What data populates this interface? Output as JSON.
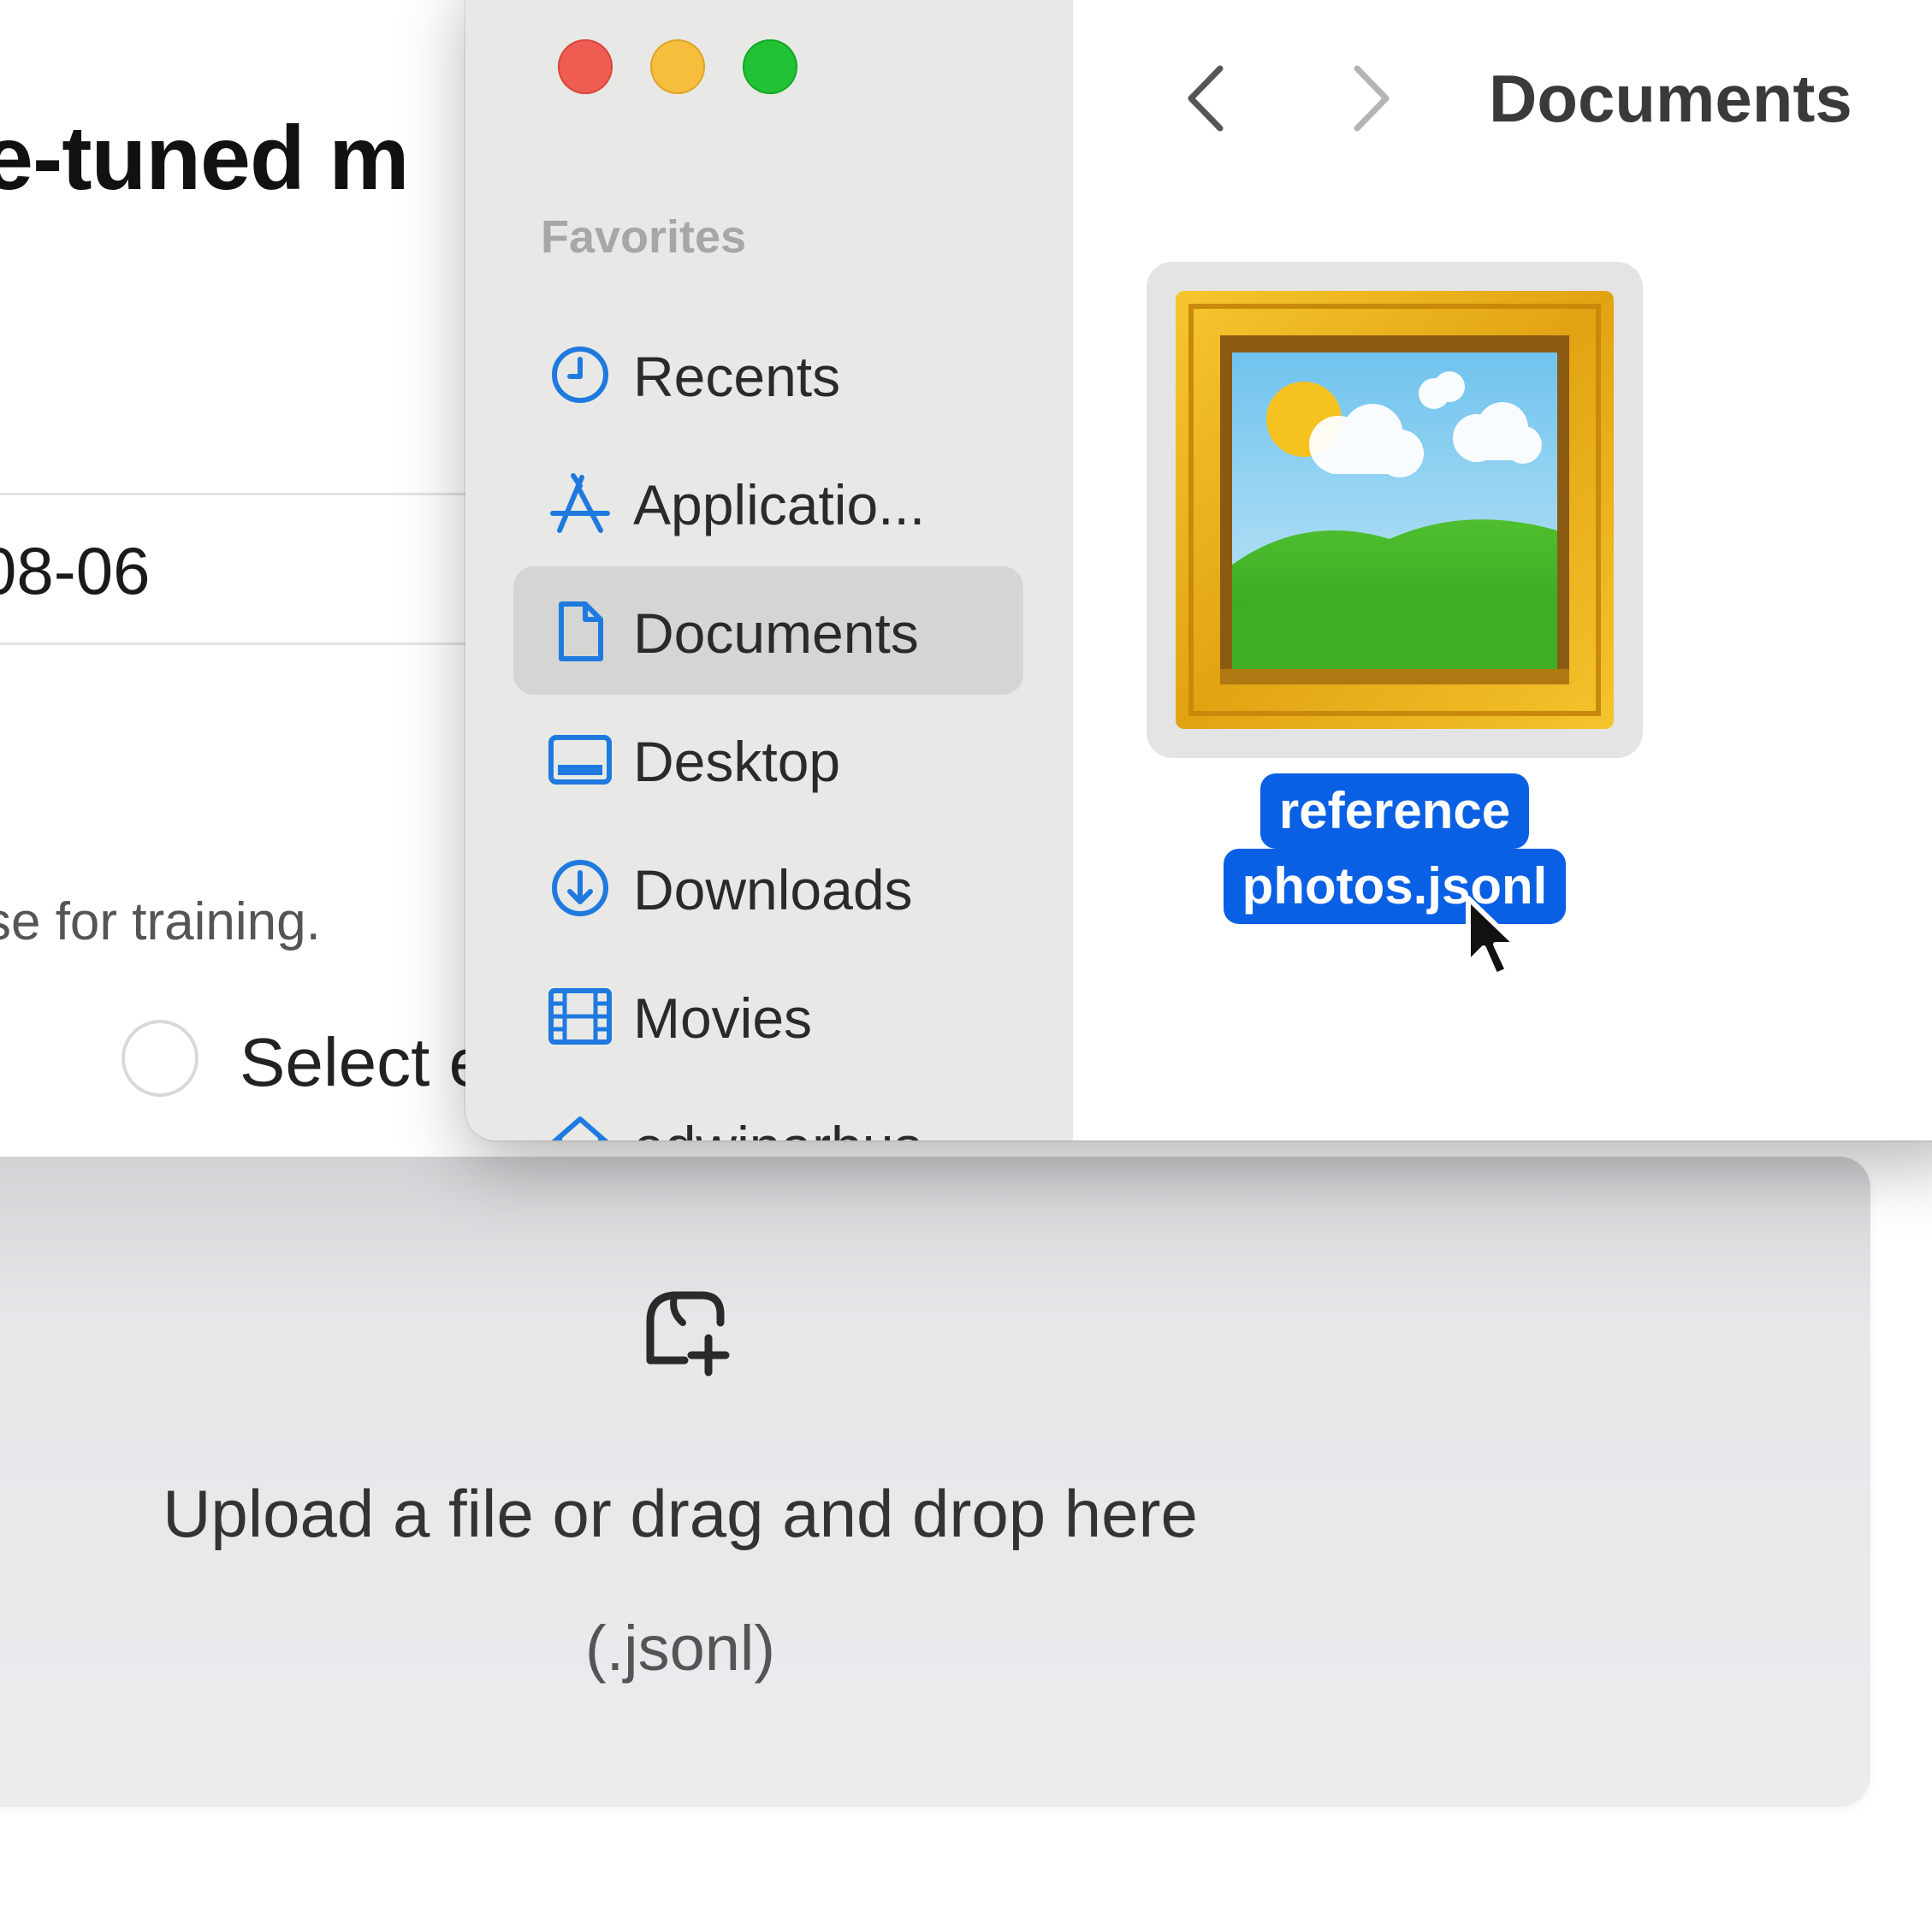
{
  "background_page": {
    "title": "e-tuned m",
    "input_value": "08-06",
    "helper_text": "se for training.",
    "radio_label": "Select e",
    "dropzone": {
      "icon": "image-plus-icon",
      "text": "Upload a file or drag and drop here",
      "extensions": "(.jsonl)"
    }
  },
  "finder": {
    "traffic_lights": [
      "close",
      "minimize",
      "zoom"
    ],
    "sidebar": {
      "section": "Favorites",
      "items": [
        {
          "label": "Recents",
          "icon": "clock-icon"
        },
        {
          "label": "Applicatio...",
          "icon": "applications-icon"
        },
        {
          "label": "Documents",
          "icon": "document-icon",
          "selected": true
        },
        {
          "label": "Desktop",
          "icon": "desktop-icon"
        },
        {
          "label": "Downloads",
          "icon": "download-icon"
        },
        {
          "label": "Movies",
          "icon": "film-icon"
        },
        {
          "label": "edwinarbus",
          "icon": "home-icon"
        }
      ]
    },
    "toolbar": {
      "back": "chevron-left-icon",
      "forward": "chevron-right-icon",
      "title": "Documents"
    },
    "files": [
      {
        "name_line1": "reference",
        "name_line2": "photos.jsonl",
        "icon": "framed-picture-icon",
        "selected": true
      }
    ]
  },
  "colors": {
    "accent": "#0a60e4",
    "sidebar_icon": "#1f7ae0",
    "traffic_close": "#ee5c52",
    "traffic_minimize": "#f6be3c",
    "traffic_zoom": "#22c236"
  }
}
